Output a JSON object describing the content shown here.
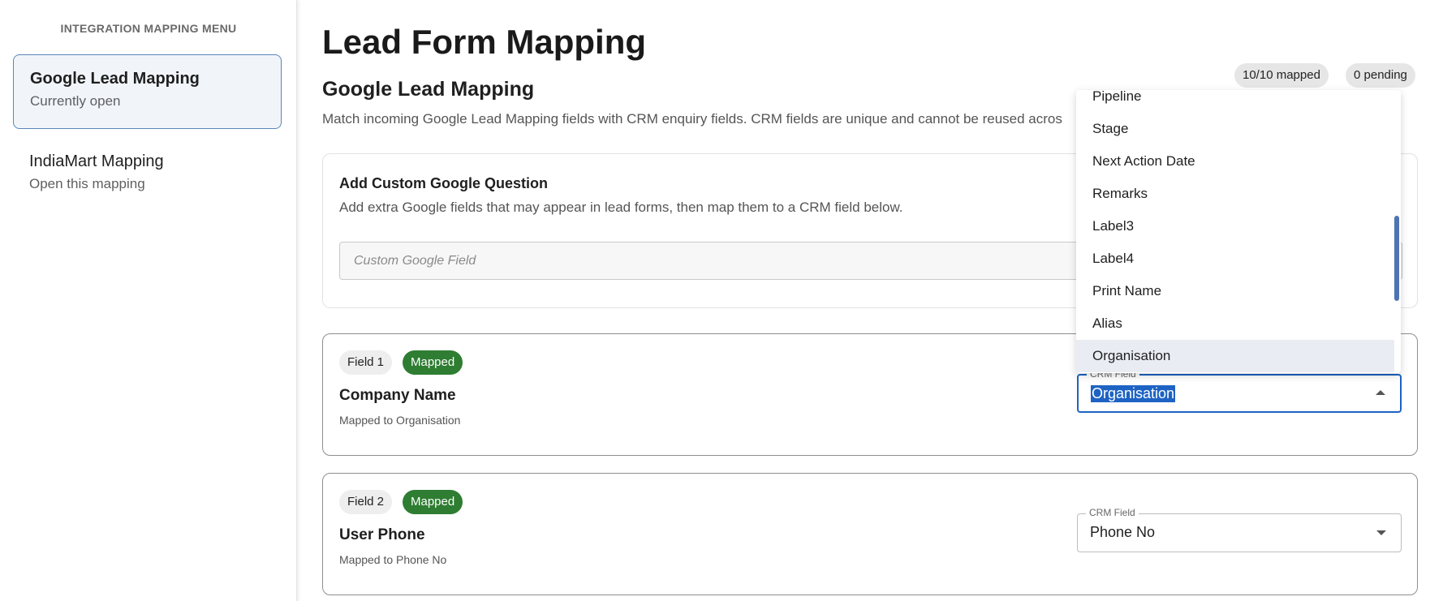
{
  "sidebar": {
    "heading": "INTEGRATION MAPPING MENU",
    "items": [
      {
        "title": "Google Lead Mapping",
        "subtitle": "Currently open"
      },
      {
        "title": "IndiaMart Mapping",
        "subtitle": "Open this mapping"
      }
    ]
  },
  "main": {
    "title": "Lead Form Mapping",
    "section_title": "Google Lead Mapping",
    "section_desc": "Match incoming Google Lead Mapping fields with CRM enquiry fields. CRM fields are unique and cannot be reused acros",
    "badges": {
      "mapped": "10/10 mapped",
      "pending": "0 pending"
    },
    "custom": {
      "title": "Add Custom Google Question",
      "desc": "Add extra Google fields that may appear in lead forms, then map them to a CRM field below.",
      "placeholder": "Custom Google Field"
    },
    "fields": [
      {
        "num": "Field 1",
        "status": "Mapped",
        "name": "Company Name",
        "mapped_to": "Mapped to Organisation",
        "crm_label": "CRM Field",
        "crm_value": "Organisation"
      },
      {
        "num": "Field 2",
        "status": "Mapped",
        "name": "User Phone",
        "mapped_to": "Mapped to Phone No",
        "crm_label": "CRM Field",
        "crm_value": "Phone No"
      }
    ]
  },
  "dropdown": {
    "options": [
      "Pipeline",
      "Stage",
      "Next Action Date",
      "Remarks",
      "Label3",
      "Label4",
      "Print Name",
      "Alias",
      "Organisation"
    ],
    "highlighted": "Organisation"
  },
  "colors": {
    "accent": "#1e63c4",
    "mapped_green": "#2e7d32",
    "active_bg": "#f1f5fa"
  }
}
